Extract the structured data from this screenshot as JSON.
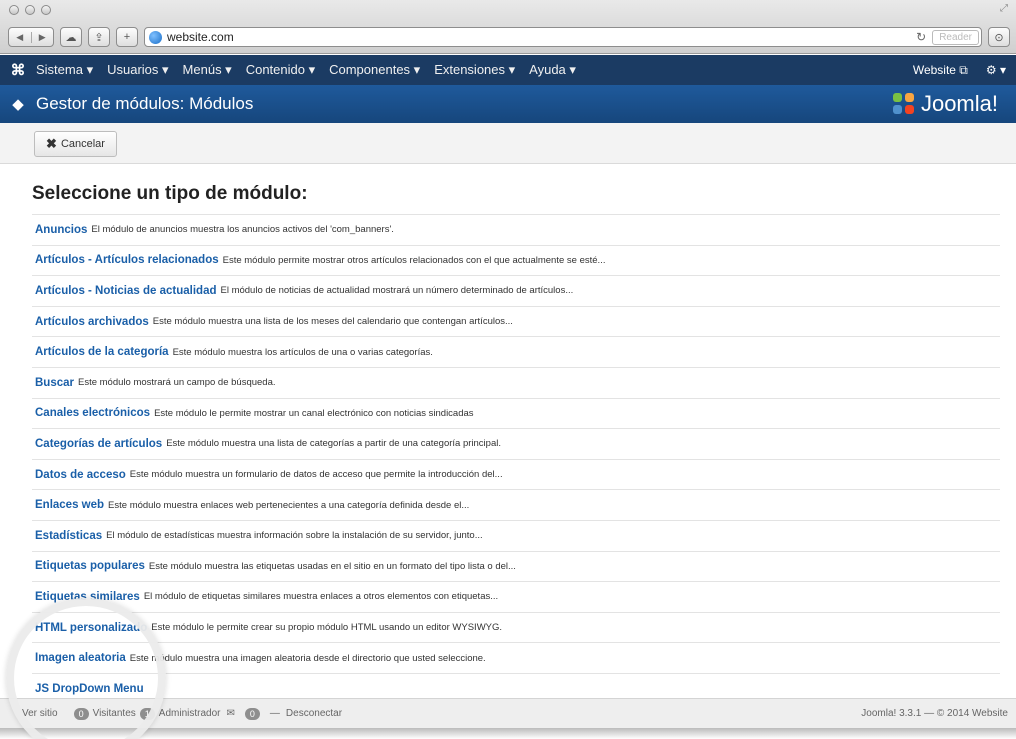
{
  "browser": {
    "url": "website.com",
    "reader_label": "Reader"
  },
  "nav": {
    "menus": [
      "Sistema ▾",
      "Usuarios ▾",
      "Menús ▾",
      "Contenido ▾",
      "Componentes ▾",
      "Extensiones ▾",
      "Ayuda ▾"
    ],
    "website_label": "Website ⧉",
    "settings_label": "⚙ ▾"
  },
  "header": {
    "title": "Gestor de módulos: Módulos",
    "brand": "Joomla!"
  },
  "toolbar": {
    "cancel_label": "Cancelar"
  },
  "content": {
    "heading": "Seleccione un tipo de módulo:",
    "modules": [
      {
        "name": "Anuncios",
        "desc": "El módulo de anuncios muestra los anuncios activos del 'com_banners'."
      },
      {
        "name": "Artículos - Artículos relacionados",
        "desc": "Este módulo permite mostrar otros artículos relacionados con el que actualmente se esté..."
      },
      {
        "name": "Artículos - Noticias de actualidad",
        "desc": "El módulo de noticias de actualidad mostrará un número determinado de artículos..."
      },
      {
        "name": "Artículos archivados",
        "desc": "Este módulo muestra una lista de los meses del calendario que contengan artículos..."
      },
      {
        "name": "Artículos de la categoría",
        "desc": "Este módulo muestra los artículos de una o varias categorías."
      },
      {
        "name": "Buscar",
        "desc": "Este módulo mostrará un campo de búsqueda."
      },
      {
        "name": "Canales electrónicos",
        "desc": "Este módulo le permite mostrar un canal electrónico con noticias sindicadas"
      },
      {
        "name": "Categorías de artículos",
        "desc": "Este módulo muestra una lista de categorías a partir de una categoría principal."
      },
      {
        "name": "Datos de acceso",
        "desc": "Este módulo muestra un formulario de datos de acceso que permite la introducción del..."
      },
      {
        "name": "Enlaces web",
        "desc": "Este módulo muestra enlaces web pertenecientes a una categoría definida desde el..."
      },
      {
        "name": "Estadísticas",
        "desc": "El módulo de estadísticas muestra información sobre la instalación de su servidor, junto..."
      },
      {
        "name": "Etiquetas populares",
        "desc": "Este módulo muestra las etiquetas usadas en el sitio en un formato del tipo lista o del..."
      },
      {
        "name": "Etiquetas similares",
        "desc": "El módulo de etiquetas similares muestra enlaces a otros elementos con etiquetas..."
      },
      {
        "name": "HTML personalizado",
        "desc": "Este módulo le permite crear su propio módulo HTML usando un editor WYSIWYG."
      },
      {
        "name": "Imagen aleatoria",
        "desc": "Este módulo muestra una imagen aleatoria desde el directorio que usted seleccione."
      },
      {
        "name": "JS DropDown Menu",
        "desc": ""
      }
    ]
  },
  "footer": {
    "view_site": "Ver sitio",
    "visitors_count": "0",
    "visitors_label": "Visitantes",
    "admin_count": "1",
    "admin_label": "Administrador",
    "messages_count": "0",
    "logout_label": "Desconectar",
    "version": "Joomla! 3.3.1 — © 2014 Website"
  },
  "colors": {
    "navbar": "#1b3b63",
    "titlebar": "#1f5a9c",
    "link": "#1a5fa8"
  }
}
